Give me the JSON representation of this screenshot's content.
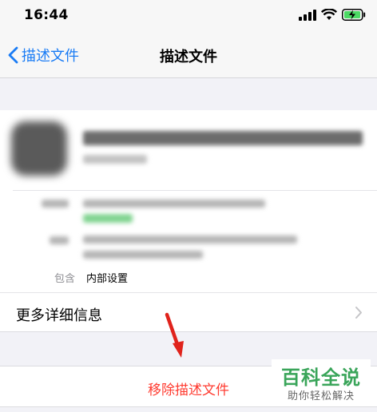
{
  "status_bar": {
    "time": "16:44"
  },
  "nav": {
    "back_label": "描述文件",
    "title": "描述文件"
  },
  "profile": {
    "contains_label": "包含",
    "contains_value": "内部设置"
  },
  "more_info": {
    "label": "更多详细信息"
  },
  "remove": {
    "label": "移除描述文件"
  },
  "watermark": {
    "title": "百科全说",
    "subtitle": "助你轻松解决"
  },
  "colors": {
    "accent": "#1a7cf5",
    "destructive": "#ff3b30",
    "watermark": "#3aa55a",
    "battery": "#4cd964"
  }
}
